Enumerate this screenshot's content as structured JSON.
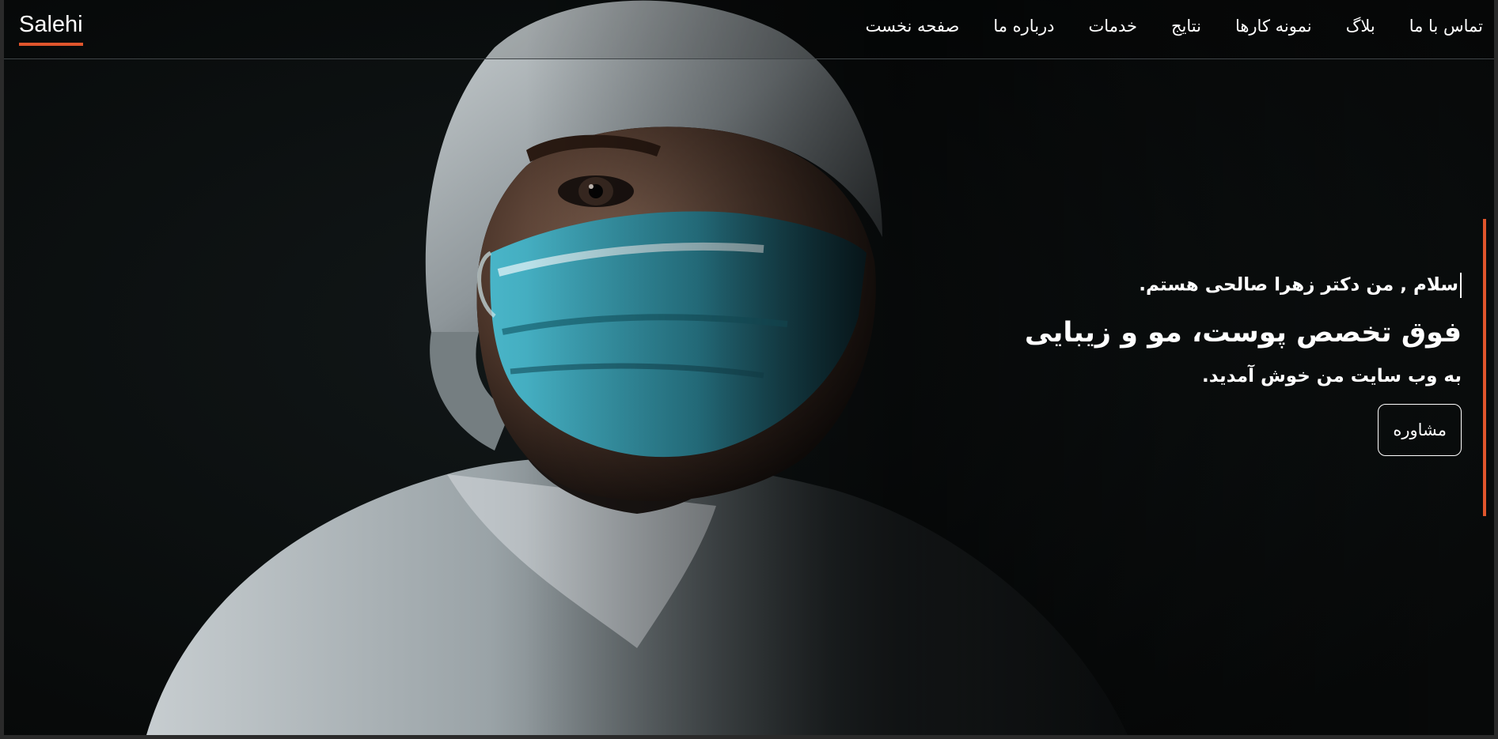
{
  "brand": {
    "logo_text": "Salehi",
    "accent_color": "#e0552c"
  },
  "nav": {
    "items": [
      {
        "label": "صفحه نخست"
      },
      {
        "label": "درباره ما"
      },
      {
        "label": "خدمات"
      },
      {
        "label": "نتایج"
      },
      {
        "label": "نمونه کارها"
      },
      {
        "label": "بلاگ"
      },
      {
        "label": "تماس با ما"
      }
    ]
  },
  "hero": {
    "greeting": "سلام , من دکتر زهرا صالحی هستم.",
    "headline": "فوق تخصص پوست، مو و زیبایی",
    "subline": "به وب سایت من خوش آمدید.",
    "cta_label": "مشاوره",
    "background_image": "doctor-in-surgical-mask-photo"
  }
}
